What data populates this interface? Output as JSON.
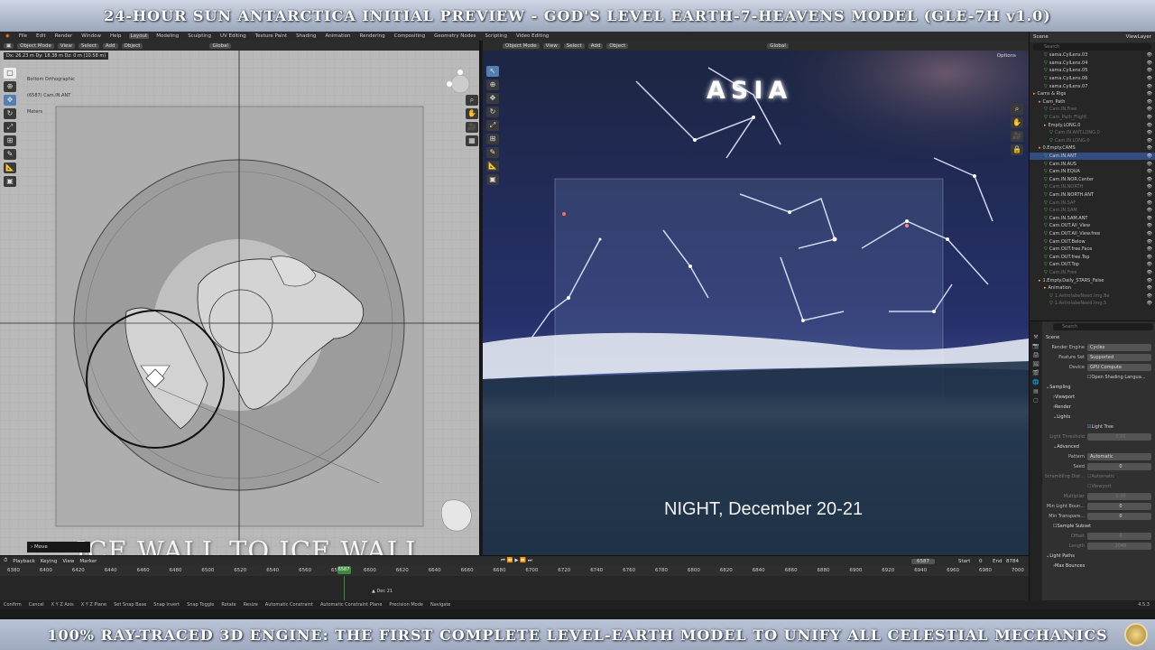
{
  "banner_top": "24-HOUR SUN ANTARCTICA INITIAL PREVIEW - GOD'S LEVEL EARTH-7-HEAVENS MODEL (GLE-7H v1.0)",
  "banner_bottom": "100% RAY-TRACED 3D ENGINE: THE FIRST COMPLETE LEVEL-EARTH MODEL TO UNIFY ALL CELESTIAL MECHANICS",
  "menu": [
    "File",
    "Edit",
    "Render",
    "Window",
    "Help"
  ],
  "workspaces": [
    "Layout",
    "Modeling",
    "Sculpting",
    "UV Editing",
    "Texture Paint",
    "Shading",
    "Animation",
    "Rendering",
    "Compositing",
    "Geometry Nodes",
    "Scripting",
    "Video Editing"
  ],
  "left_viewport": {
    "mode": "Object Mode",
    "menus": [
      "View",
      "Select",
      "Add",
      "Object"
    ],
    "orientation": "Global",
    "readout": "Dx: 26.23 m  Dy: 18.38 m  Dz: 0 m (10.58 m)",
    "info_lines": [
      "Bottom Orthographic",
      "(6587) Cam.IN.ANT",
      "Meters"
    ],
    "caption": "ICE WALL TO ICE WALL",
    "operator_panel": "Move"
  },
  "right_viewport": {
    "mode": "Object Mode",
    "menus": [
      "View",
      "Select",
      "Add",
      "Object"
    ],
    "orientation": "Global",
    "options_label": "Options",
    "asia_title": "ASIA",
    "night_caption": "NIGHT, December 20-21"
  },
  "outliner": {
    "header": "Scene",
    "view_layer": "ViewLayer",
    "search_placeholder": "Search",
    "rows": [
      {
        "label": "sama.CylLens.03",
        "kind": "cam",
        "dim": false,
        "sel": false,
        "indent": 2
      },
      {
        "label": "sama.CylLens.04",
        "kind": "cam",
        "dim": false,
        "sel": false,
        "indent": 2
      },
      {
        "label": "sama.CylLens.05",
        "kind": "cam",
        "dim": false,
        "sel": false,
        "indent": 2
      },
      {
        "label": "sama.CylLens.06",
        "kind": "cam",
        "dim": false,
        "sel": false,
        "indent": 2
      },
      {
        "label": "sama.CylLens.07",
        "kind": "cam",
        "dim": false,
        "sel": false,
        "indent": 2
      },
      {
        "label": "Cams & Rigs",
        "kind": "coll",
        "dim": false,
        "sel": false,
        "indent": 0
      },
      {
        "label": "Cam_Path",
        "kind": "coll",
        "dim": false,
        "sel": false,
        "indent": 1
      },
      {
        "label": "Cam.IN.Free",
        "kind": "cam",
        "dim": true,
        "sel": false,
        "indent": 2
      },
      {
        "label": "Cam_Path_Flight",
        "kind": "cam",
        "dim": true,
        "sel": false,
        "indent": 2
      },
      {
        "label": "Empty.LONG.0",
        "kind": "coll",
        "dim": false,
        "sel": false,
        "indent": 2
      },
      {
        "label": "Cam.IN.ANT.LONG.0",
        "kind": "cam",
        "dim": true,
        "sel": false,
        "indent": 3
      },
      {
        "label": "Cam.IN.LONG.0",
        "kind": "cam",
        "dim": true,
        "sel": false,
        "indent": 3
      },
      {
        "label": "0.Empty.CAMS",
        "kind": "coll",
        "dim": false,
        "sel": false,
        "indent": 1
      },
      {
        "label": "Cam.IN.ANT",
        "kind": "cam",
        "dim": false,
        "sel": true,
        "indent": 2
      },
      {
        "label": "Cam.IN.AUS",
        "kind": "cam",
        "dim": false,
        "sel": false,
        "indent": 2
      },
      {
        "label": "Cam.IN.EQUA",
        "kind": "cam",
        "dim": false,
        "sel": false,
        "indent": 2
      },
      {
        "label": "Cam.IN.NOR.Center",
        "kind": "cam",
        "dim": false,
        "sel": false,
        "indent": 2
      },
      {
        "label": "Cam.IN.NORTH",
        "kind": "cam",
        "dim": true,
        "sel": false,
        "indent": 2
      },
      {
        "label": "Cam.IN.NORTH.ANT",
        "kind": "cam",
        "dim": false,
        "sel": false,
        "indent": 2
      },
      {
        "label": "Cam.IN.SAF",
        "kind": "cam",
        "dim": true,
        "sel": false,
        "indent": 2
      },
      {
        "label": "Cam.IN.SAM",
        "kind": "cam",
        "dim": true,
        "sel": false,
        "indent": 2
      },
      {
        "label": "Cam.IN.SAM.ANT",
        "kind": "cam",
        "dim": false,
        "sel": false,
        "indent": 2
      },
      {
        "label": "Cam.OUT.All_View",
        "kind": "cam",
        "dim": false,
        "sel": false,
        "indent": 2
      },
      {
        "label": "Cam.OUT.All_View.free",
        "kind": "cam",
        "dim": false,
        "sel": false,
        "indent": 2
      },
      {
        "label": "Cam.OUT.Below",
        "kind": "cam",
        "dim": false,
        "sel": false,
        "indent": 2
      },
      {
        "label": "Cam.OUT.free.Face",
        "kind": "cam",
        "dim": false,
        "sel": false,
        "indent": 2
      },
      {
        "label": "Cam.OUT.free.Top",
        "kind": "cam",
        "dim": false,
        "sel": false,
        "indent": 2
      },
      {
        "label": "Cam.OUT.Top",
        "kind": "cam",
        "dim": false,
        "sel": false,
        "indent": 2
      },
      {
        "label": "Cam.IN.Free",
        "kind": "cam",
        "dim": true,
        "sel": false,
        "indent": 2
      },
      {
        "label": "1.Empty.Daily_STARS_False",
        "kind": "coll",
        "dim": false,
        "sel": false,
        "indent": 1
      },
      {
        "label": "Animation",
        "kind": "coll",
        "dim": false,
        "sel": false,
        "indent": 2
      },
      {
        "label": "1.AstrolabeNeed.Img.Be",
        "kind": "cam",
        "dim": true,
        "sel": false,
        "indent": 3
      },
      {
        "label": "1.AstrolabeNeed.Img.S",
        "kind": "cam",
        "dim": true,
        "sel": false,
        "indent": 3
      }
    ]
  },
  "properties": {
    "search_placeholder": "Search",
    "scene_label": "Scene",
    "render_engine_label": "Render Engine",
    "render_engine": "Cycles",
    "feature_set_label": "Feature Set",
    "feature_set": "Supported",
    "device_label": "Device",
    "device": "GPU Compute",
    "osl_label": "Open Shading Langua...",
    "sampling": "Sampling",
    "viewport": "Viewport",
    "render": "Render",
    "lights": "Lights",
    "light_tree": "Light Tree",
    "light_threshold_label": "Light Threshold",
    "light_threshold": "0.01",
    "advanced": "Advanced",
    "pattern_label": "Pattern",
    "pattern": "Automatic",
    "seed_label": "Seed",
    "seed": "0",
    "scrambling_label": "Scrambling Dist...",
    "scrambling_auto": "Automatic",
    "scrambling_viewport": "Viewport",
    "multiplier_label": "Multiplier",
    "multiplier": "1.00",
    "min_light_bounces_label": "Min Light Boun...",
    "min_light_bounces": "0",
    "min_transparent_label": "Min Transpare...",
    "min_transparent": "0",
    "sample_subset": "Sample Subset",
    "offset_label": "Offset",
    "offset": "0",
    "length_label": "Length",
    "length": "2048",
    "light_paths": "Light Paths",
    "max_bounces": "Max Bounces"
  },
  "timeline": {
    "menus": [
      "Playback",
      "Keying",
      "View",
      "Marker"
    ],
    "current_frame": "6587",
    "start_label": "Start",
    "start": "0",
    "end_label": "End",
    "end": "8784",
    "ticks": [
      "6380",
      "6400",
      "6420",
      "6440",
      "6460",
      "6480",
      "6500",
      "6520",
      "6540",
      "6560",
      "6580",
      "6600",
      "6620",
      "6640",
      "6660",
      "6680",
      "6700",
      "6720",
      "6740",
      "6760",
      "6780",
      "6800",
      "6820",
      "6840",
      "6860",
      "6880",
      "6900",
      "6920",
      "6940",
      "6960",
      "6980",
      "7000"
    ],
    "marker": "Dec 21"
  },
  "statusbar": [
    "Confirm",
    "Cancel",
    "X Y Z Axis",
    "X Y Z Plane",
    "Set Snap Base",
    "Snap Invert",
    "Snap Toggle",
    "Rotate",
    "Resize",
    "Automatic Constraint",
    "Automatic Constraint Plane",
    "Precision Mode",
    "Navigate"
  ],
  "version": "4.5.3"
}
